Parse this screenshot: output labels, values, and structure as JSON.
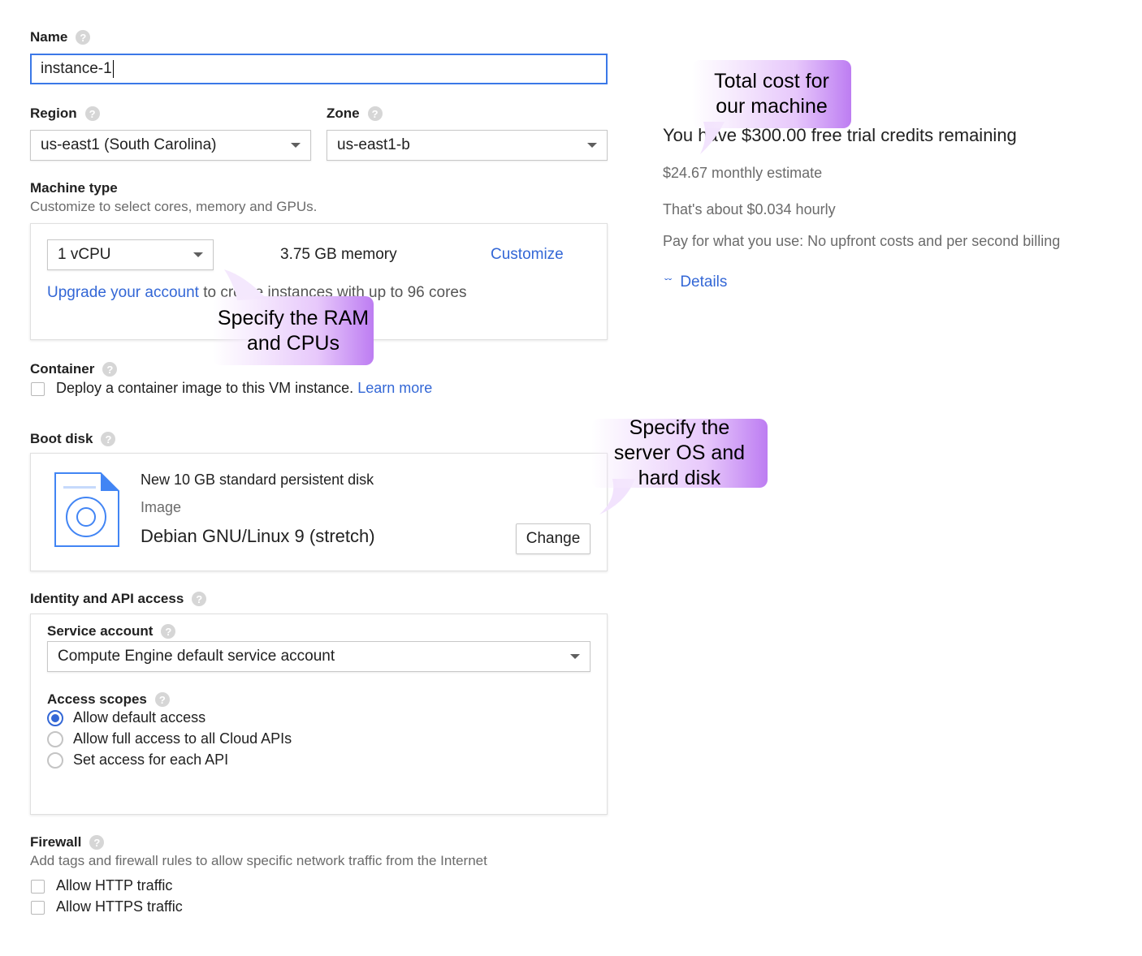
{
  "name": {
    "label": "Name",
    "value": "instance-1"
  },
  "region": {
    "label": "Region",
    "value": "us-east1 (South Carolina)"
  },
  "zone": {
    "label": "Zone",
    "value": "us-east1-b"
  },
  "machine_type": {
    "label": "Machine type",
    "description": "Customize to select cores, memory and GPUs.",
    "cpu_value": "1 vCPU",
    "memory": "3.75 GB memory",
    "customize_label": "Customize",
    "upgrade_link": "Upgrade your account",
    "upgrade_text": "to create instances with up to 96 cores"
  },
  "container": {
    "label": "Container",
    "checkbox_label": "Deploy a container image to this VM instance.",
    "learn_more": "Learn more"
  },
  "boot_disk": {
    "label": "Boot disk",
    "disk_title": "New 10 GB standard persistent disk",
    "image_label": "Image",
    "image_value": "Debian GNU/Linux 9 (stretch)",
    "change_label": "Change"
  },
  "identity": {
    "label": "Identity and API access",
    "service_account_label": "Service account",
    "service_account_value": "Compute Engine default service account",
    "access_scopes_label": "Access scopes",
    "scopes": [
      {
        "label": "Allow default access",
        "selected": true
      },
      {
        "label": "Allow full access to all Cloud APIs",
        "selected": false
      },
      {
        "label": "Set access for each API",
        "selected": false
      }
    ]
  },
  "firewall": {
    "label": "Firewall",
    "description": "Add tags and firewall rules to allow specific network traffic from the Internet",
    "options": [
      "Allow HTTP traffic",
      "Allow HTTPS traffic"
    ]
  },
  "cost": {
    "credits": "You have $300.00 free trial credits remaining",
    "monthly": "$24.67 monthly estimate",
    "hourly": "That's about $0.034 hourly",
    "billing": "Pay for what you use: No upfront costs and per second billing",
    "details_label": "Details"
  },
  "annotations": {
    "cost": "Total cost for our machine",
    "ram_cpu": "Specify the RAM and CPUs",
    "disk": "Specify the server OS and hard disk"
  },
  "colors": {
    "link": "#3367d6",
    "focus": "#3b78e7",
    "bubble_accent": "#bd7df2"
  }
}
